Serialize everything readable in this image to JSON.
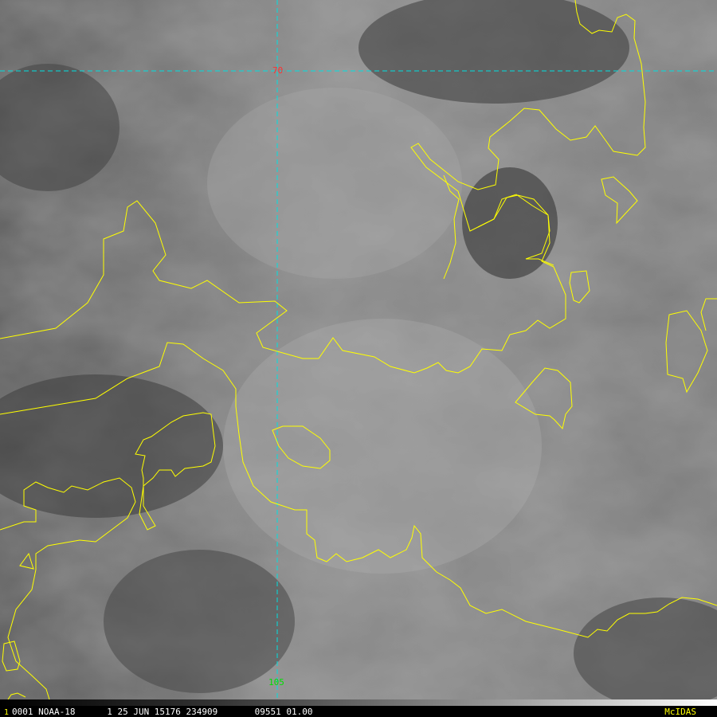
{
  "colors": {
    "coastline": "#ffff00",
    "grid_lines": "#00e0e0",
    "lat_label": "#ff3030",
    "lon_label": "#00e000",
    "status_text": "#ffffff",
    "brand": "#ffff00"
  },
  "grid": {
    "latitude_label": "70",
    "longitude_label": "105"
  },
  "status": {
    "frame_number": "1",
    "line": "0001 NOAA-18      1 25 JUN 15176 234909       09551 01.00",
    "brand": "McIDAS"
  }
}
